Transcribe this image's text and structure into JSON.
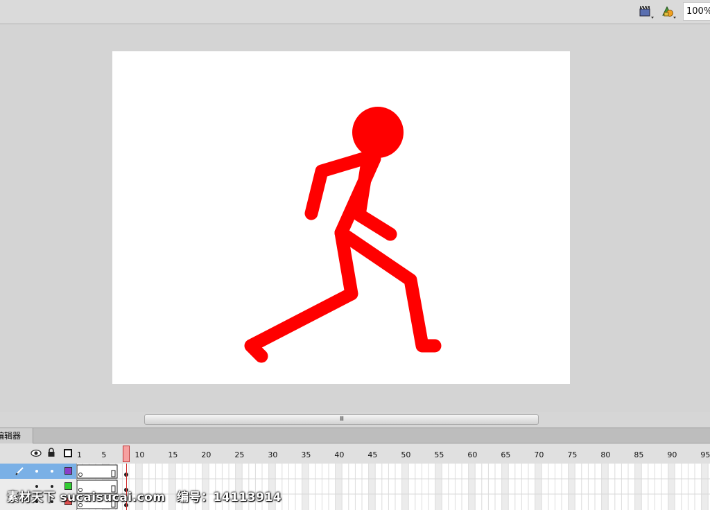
{
  "toolbar": {
    "zoom_value": "100%",
    "icons": [
      "edit-scene-icon",
      "edit-symbols-icon"
    ]
  },
  "scrollbar": {
    "thumb_grip": "III"
  },
  "panel": {
    "tab_label": "编辑器"
  },
  "timeline": {
    "frame_numbers": [
      "1",
      "5",
      "10",
      "15",
      "20",
      "25",
      "30",
      "35",
      "40",
      "45",
      "50",
      "55",
      "60",
      "65",
      "70",
      "75",
      "80",
      "85",
      "90",
      "95"
    ],
    "current_frame": 8,
    "header_icons": [
      "eye-icon",
      "lock-icon",
      "outline-icon"
    ],
    "layers": [
      {
        "selected": true,
        "color": "#8a3dc8"
      },
      {
        "selected": false,
        "color": "#33cc33"
      },
      {
        "selected": false,
        "color": "#e05050"
      }
    ]
  },
  "stage": {
    "figure_color": "#ff0000",
    "background": "#ffffff"
  },
  "watermark": {
    "site": "素材天下 sucaisucai.com",
    "id_label": "编号：14113914"
  }
}
